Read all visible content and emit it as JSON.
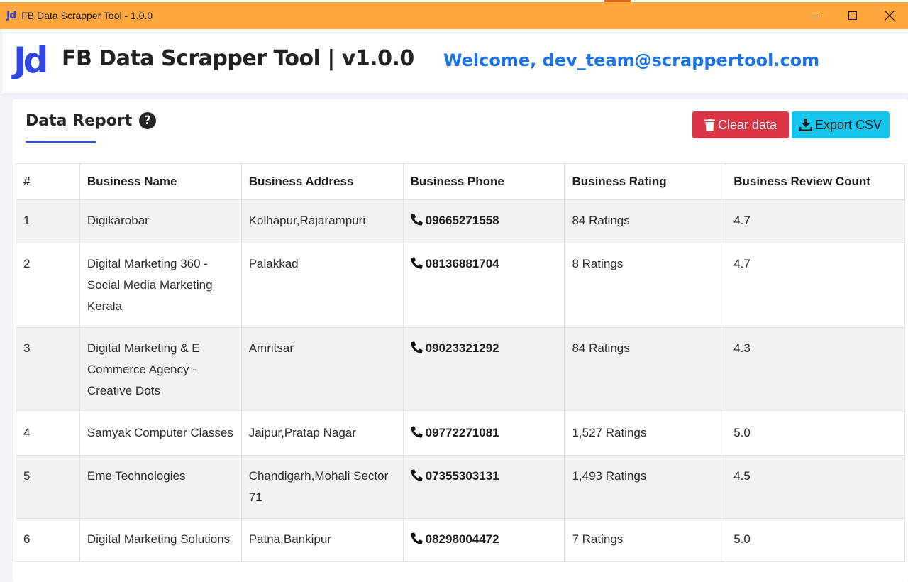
{
  "window": {
    "logo": "Jd",
    "title": "FB Data Scrapper Tool - 1.0.0",
    "controls": [
      "minimize",
      "maximize",
      "close"
    ]
  },
  "header": {
    "logo": "Jd",
    "title": "FB Data Scrapper Tool | v1.0.0",
    "welcome": "Welcome, dev_team@scrappertool.com"
  },
  "report": {
    "title": "Data Report",
    "help_icon": "?",
    "clear_label": "Clear data",
    "export_label": "Export CSV"
  },
  "table": {
    "headers": [
      "#",
      "Business Name",
      "Business Address",
      "Business Phone",
      "Business Rating",
      "Business Review Count"
    ],
    "rows": [
      {
        "num": "1",
        "name": "Digikarobar",
        "address": "Kolhapur,Rajarampuri",
        "phone": "09665271558",
        "rating": "84 Ratings",
        "reviews": "4.7"
      },
      {
        "num": "2",
        "name": "Digital Marketing 360 - Social Media Marketing Kerala",
        "address": "Palakkad",
        "phone": "08136881704",
        "rating": "8 Ratings",
        "reviews": "4.7"
      },
      {
        "num": "3",
        "name": "Digital Marketing & E Commerce Agency - Creative Dots",
        "address": "Amritsar",
        "phone": "09023321292",
        "rating": "84 Ratings",
        "reviews": "4.3"
      },
      {
        "num": "4",
        "name": "Samyak Computer Classes",
        "address": "Jaipur,Pratap Nagar",
        "phone": "09772271081",
        "rating": "1,527 Ratings",
        "reviews": "5.0"
      },
      {
        "num": "5",
        "name": "Eme Technologies",
        "address": "Chandigarh,Mohali Sector 71",
        "phone": "07355303131",
        "rating": "1,493 Ratings",
        "reviews": "4.5"
      },
      {
        "num": "6",
        "name": "Digital Marketing Solutions",
        "address": "Patna,Bankipur",
        "phone": "08298004472",
        "rating": "7 Ratings",
        "reviews": "5.0"
      }
    ]
  },
  "colors": {
    "titlebar": "#ffa73d",
    "logo": "#3048e0",
    "welcome": "#1a73e8",
    "clear_button": "#dc3545",
    "export_button": "#14c5ee",
    "accent_underline": "#3553d9"
  },
  "icons": {
    "clear": "trash-icon",
    "export": "download-icon",
    "phone": "phone-icon",
    "help": "question-circle-icon"
  }
}
